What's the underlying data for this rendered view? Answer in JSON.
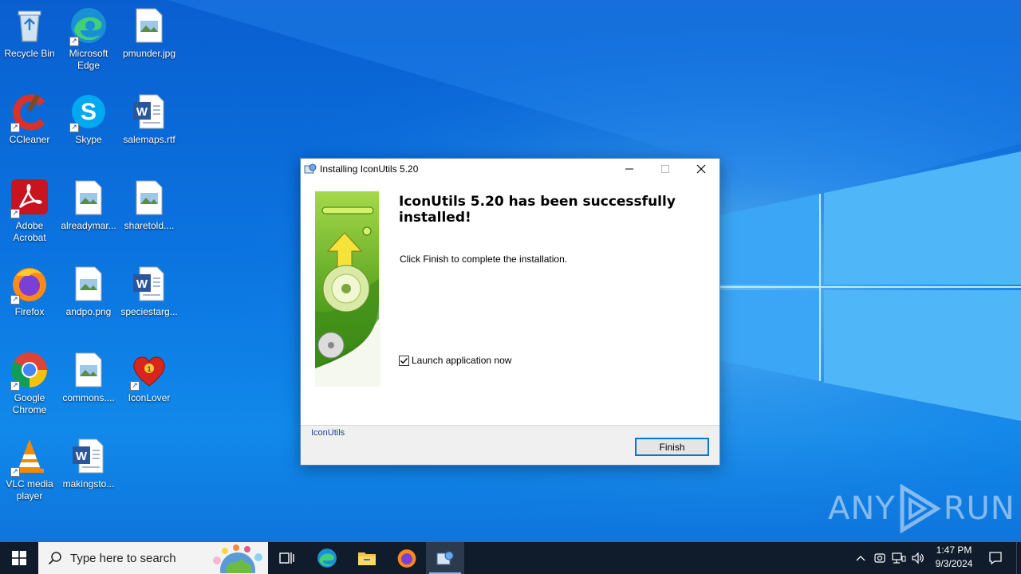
{
  "desktop": {
    "icons": [
      {
        "label": "Recycle Bin",
        "icon": "recycle-bin-icon"
      },
      {
        "label": "Microsoft Edge",
        "icon": "edge-icon"
      },
      {
        "label": "pmunder.jpg",
        "icon": "image-file-icon"
      },
      {
        "label": "CCleaner",
        "icon": "ccleaner-icon"
      },
      {
        "label": "Skype",
        "icon": "skype-icon"
      },
      {
        "label": "salemaps.rtf",
        "icon": "word-doc-icon"
      },
      {
        "label": "Adobe Acrobat",
        "icon": "acrobat-icon"
      },
      {
        "label": "alreadymar...",
        "icon": "image-file-icon"
      },
      {
        "label": "sharetold....",
        "icon": "image-file-icon"
      },
      {
        "label": "Firefox",
        "icon": "firefox-icon"
      },
      {
        "label": "andpo.png",
        "icon": "image-file-icon"
      },
      {
        "label": "speciestarg...",
        "icon": "word-doc-icon"
      },
      {
        "label": "Google Chrome",
        "icon": "chrome-icon"
      },
      {
        "label": "commons....",
        "icon": "image-file-icon"
      },
      {
        "label": "IconLover",
        "icon": "iconlover-icon"
      },
      {
        "label": "VLC media player",
        "icon": "vlc-icon"
      },
      {
        "label": "makingsto...",
        "icon": "word-doc-icon"
      }
    ]
  },
  "dialog": {
    "title": "Installing IconUtils 5.20",
    "heading": "IconUtils 5.20 has been successfully installed!",
    "subtext": "Click Finish to complete the installation.",
    "checkbox_label": "Launch application now",
    "checkbox_checked": true,
    "brand": "IconUtils",
    "finish_label": "Finish"
  },
  "watermark": {
    "left": "ANY",
    "right": "RUN"
  },
  "taskbar": {
    "search_placeholder": "Type here to search",
    "time": "1:47 PM",
    "date": "9/3/2024",
    "pinned": [
      "task-view-icon",
      "edge-icon",
      "file-explorer-icon",
      "firefox-icon",
      "installer-icon"
    ]
  },
  "colors": {
    "desktop_blue": "#0b74e0",
    "taskbar": "#101c2c",
    "accent": "#0078d7",
    "banner_green": "#6ab42a"
  }
}
